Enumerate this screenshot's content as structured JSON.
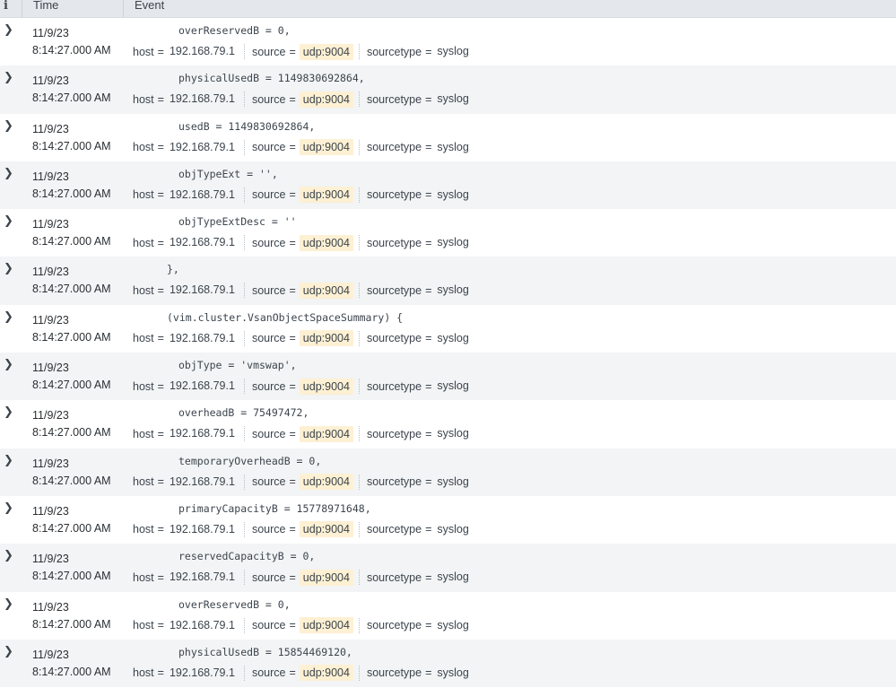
{
  "header": {
    "info_icon": "i",
    "time_label": "Time",
    "event_label": "Event"
  },
  "field_labels": {
    "host": "host",
    "source": "source",
    "sourcetype": "sourcetype",
    "eq": "="
  },
  "rows": [
    {
      "date": "11/9/23",
      "clock": "8:14:27.000 AM",
      "raw": "overReservedB = 0,",
      "indent": 2,
      "host": "192.168.79.1",
      "source": "udp:9004",
      "sourcetype": "syslog"
    },
    {
      "date": "11/9/23",
      "clock": "8:14:27.000 AM",
      "raw": "physicalUsedB = 1149830692864,",
      "indent": 2,
      "host": "192.168.79.1",
      "source": "udp:9004",
      "sourcetype": "syslog"
    },
    {
      "date": "11/9/23",
      "clock": "8:14:27.000 AM",
      "raw": "usedB = 1149830692864,",
      "indent": 2,
      "host": "192.168.79.1",
      "source": "udp:9004",
      "sourcetype": "syslog"
    },
    {
      "date": "11/9/23",
      "clock": "8:14:27.000 AM",
      "raw": "objTypeExt = '',",
      "indent": 2,
      "host": "192.168.79.1",
      "source": "udp:9004",
      "sourcetype": "syslog"
    },
    {
      "date": "11/9/23",
      "clock": "8:14:27.000 AM",
      "raw": "objTypeExtDesc = ''",
      "indent": 2,
      "host": "192.168.79.1",
      "source": "udp:9004",
      "sourcetype": "syslog"
    },
    {
      "date": "11/9/23",
      "clock": "8:14:27.000 AM",
      "raw": "},",
      "indent": 1,
      "host": "192.168.79.1",
      "source": "udp:9004",
      "sourcetype": "syslog"
    },
    {
      "date": "11/9/23",
      "clock": "8:14:27.000 AM",
      "raw": "(vim.cluster.VsanObjectSpaceSummary) {",
      "indent": 1,
      "host": "192.168.79.1",
      "source": "udp:9004",
      "sourcetype": "syslog"
    },
    {
      "date": "11/9/23",
      "clock": "8:14:27.000 AM",
      "raw": "objType = 'vmswap',",
      "indent": 2,
      "host": "192.168.79.1",
      "source": "udp:9004",
      "sourcetype": "syslog"
    },
    {
      "date": "11/9/23",
      "clock": "8:14:27.000 AM",
      "raw": "overheadB = 75497472,",
      "indent": 2,
      "host": "192.168.79.1",
      "source": "udp:9004",
      "sourcetype": "syslog"
    },
    {
      "date": "11/9/23",
      "clock": "8:14:27.000 AM",
      "raw": "temporaryOverheadB = 0,",
      "indent": 2,
      "host": "192.168.79.1",
      "source": "udp:9004",
      "sourcetype": "syslog"
    },
    {
      "date": "11/9/23",
      "clock": "8:14:27.000 AM",
      "raw": "primaryCapacityB = 15778971648,",
      "indent": 2,
      "host": "192.168.79.1",
      "source": "udp:9004",
      "sourcetype": "syslog"
    },
    {
      "date": "11/9/23",
      "clock": "8:14:27.000 AM",
      "raw": "reservedCapacityB = 0,",
      "indent": 2,
      "host": "192.168.79.1",
      "source": "udp:9004",
      "sourcetype": "syslog"
    },
    {
      "date": "11/9/23",
      "clock": "8:14:27.000 AM",
      "raw": "overReservedB = 0,",
      "indent": 2,
      "host": "192.168.79.1",
      "source": "udp:9004",
      "sourcetype": "syslog"
    },
    {
      "date": "11/9/23",
      "clock": "8:14:27.000 AM",
      "raw": "physicalUsedB = 15854469120,",
      "indent": 2,
      "host": "192.168.79.1",
      "source": "udp:9004",
      "sourcetype": "syslog"
    }
  ],
  "colors": {
    "header_bg": "#e4e7eb",
    "alt_row_bg": "#f2f4f5",
    "highlight_bg": "#fdf0d3"
  },
  "icons": {
    "expand": "chevron-right-icon",
    "info": "info-icon"
  }
}
